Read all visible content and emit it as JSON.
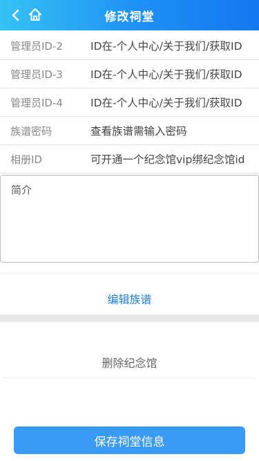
{
  "header": {
    "title": "修改祠堂",
    "back_icon": "back-arrow-icon",
    "home_icon": "home-icon"
  },
  "fields": [
    {
      "label": "管理员ID-2",
      "value": "ID在-个人中心/关于我们/获取ID"
    },
    {
      "label": "管理员ID-3",
      "value": "ID在-个人中心/关于我们/获取ID"
    },
    {
      "label": "管理员ID-4",
      "value": "ID在-个人中心/关于我们/获取ID"
    },
    {
      "label": "族谱密码",
      "value": "查看族谱需输入密码"
    },
    {
      "label": "相册ID",
      "value": "可开通一个纪念馆vip绑纪念馆id"
    }
  ],
  "intro": {
    "placeholder": "简介"
  },
  "actions": {
    "edit_genealogy": "编辑族谱",
    "delete_memorial": "删除纪念馆",
    "save": "保存祠堂信息"
  },
  "colors": {
    "header_start": "#36c2f5",
    "header_end": "#1577f0",
    "link_blue": "#1e7fd8",
    "save_button": "#3a9bf7"
  }
}
